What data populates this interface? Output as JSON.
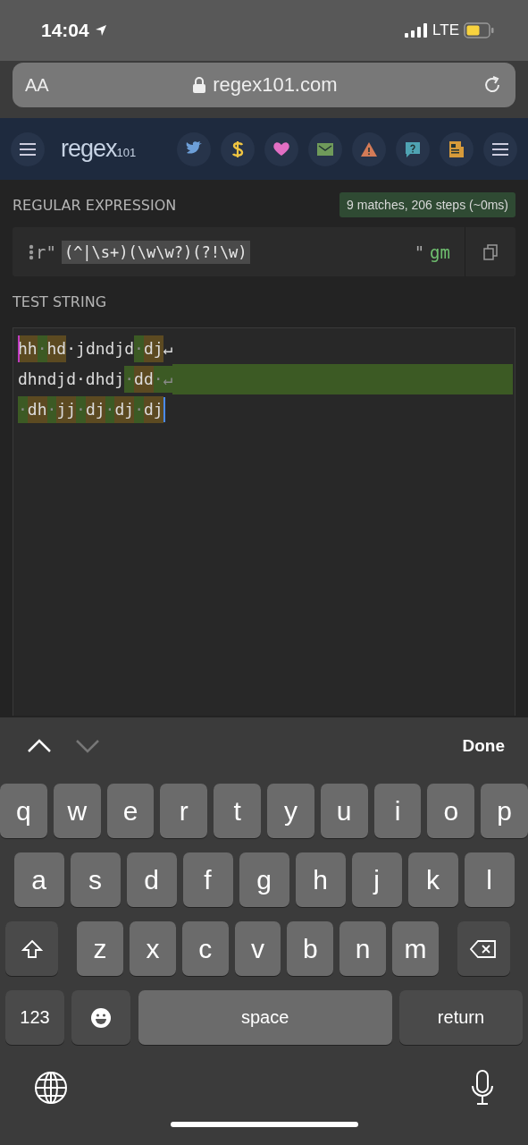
{
  "status_bar": {
    "time": "14:04",
    "network": "LTE"
  },
  "address_bar": {
    "text_size": "AA",
    "url": "regex101.com"
  },
  "nav": {
    "logo": "regex",
    "logo_suffix": "101",
    "buttons": [
      {
        "kind": "twitter"
      },
      {
        "kind": "dollar"
      },
      {
        "kind": "heart"
      },
      {
        "kind": "mail"
      },
      {
        "kind": "warning"
      },
      {
        "kind": "help"
      },
      {
        "kind": "news"
      }
    ]
  },
  "regex": {
    "label": "REGULAR EXPRESSION",
    "match_info": "9 matches, 206 steps (~0ms)",
    "prefix": "r\"",
    "pattern": "(^|\\s+)(\\w\\w?)(?!\\w)",
    "suffix": "\"",
    "flags": "gm"
  },
  "test_string": {
    "label": "TEST STRING",
    "lines": [
      {
        "trailing_match": false,
        "segments": [
          {
            "text": "hh",
            "kind": "word"
          },
          {
            "text": "·",
            "kind": "space"
          },
          {
            "text": "hd",
            "kind": "word"
          },
          {
            "text": "·jdndjd",
            "kind": "plain"
          },
          {
            "text": "·",
            "kind": "space"
          },
          {
            "text": "dj",
            "kind": "word"
          },
          {
            "text": "↵",
            "kind": "plain"
          }
        ]
      },
      {
        "trailing_match": true,
        "segments": [
          {
            "text": "dhndjd·dhdj",
            "kind": "plain"
          },
          {
            "text": "·",
            "kind": "space"
          },
          {
            "text": "dd",
            "kind": "word"
          },
          {
            "text": "·↵",
            "kind": "space"
          }
        ]
      },
      {
        "trailing_match": false,
        "segments": [
          {
            "text": "·",
            "kind": "space"
          },
          {
            "text": "dh",
            "kind": "word"
          },
          {
            "text": "·",
            "kind": "space"
          },
          {
            "text": "jj",
            "kind": "word"
          },
          {
            "text": "·",
            "kind": "space"
          },
          {
            "text": "dj",
            "kind": "word"
          },
          {
            "text": "·",
            "kind": "space"
          },
          {
            "text": "dj",
            "kind": "word"
          },
          {
            "text": "·",
            "kind": "space"
          },
          {
            "text": "dj",
            "kind": "word"
          }
        ]
      }
    ]
  },
  "keyboard": {
    "done": "Done",
    "rows": [
      {
        "keys": [
          {
            "label": "q",
            "kind": "letter"
          },
          {
            "label": "w",
            "kind": "letter"
          },
          {
            "label": "e",
            "kind": "letter"
          },
          {
            "label": "r",
            "kind": "letter"
          },
          {
            "label": "t",
            "kind": "letter"
          },
          {
            "label": "y",
            "kind": "letter"
          },
          {
            "label": "u",
            "kind": "letter"
          },
          {
            "label": "i",
            "kind": "letter"
          },
          {
            "label": "o",
            "kind": "letter"
          },
          {
            "label": "p",
            "kind": "letter"
          }
        ]
      },
      {
        "keys": [
          {
            "label": "a",
            "kind": "letter"
          },
          {
            "label": "s",
            "kind": "letter"
          },
          {
            "label": "d",
            "kind": "letter"
          },
          {
            "label": "f",
            "kind": "letter"
          },
          {
            "label": "g",
            "kind": "letter"
          },
          {
            "label": "h",
            "kind": "letter"
          },
          {
            "label": "j",
            "kind": "letter"
          },
          {
            "label": "k",
            "kind": "letter"
          },
          {
            "label": "l",
            "kind": "letter"
          }
        ]
      },
      {
        "keys": [
          {
            "kind": "shift"
          },
          {
            "label": "z",
            "kind": "letter"
          },
          {
            "label": "x",
            "kind": "letter"
          },
          {
            "label": "c",
            "kind": "letter"
          },
          {
            "label": "v",
            "kind": "letter"
          },
          {
            "label": "b",
            "kind": "letter"
          },
          {
            "label": "n",
            "kind": "letter"
          },
          {
            "label": "m",
            "kind": "letter"
          },
          {
            "kind": "delete"
          }
        ]
      }
    ],
    "bottom_row": [
      {
        "label": "123",
        "kind": "mode"
      },
      {
        "kind": "emoji"
      },
      {
        "label": "space",
        "kind": "space"
      },
      {
        "label": "return",
        "kind": "return"
      }
    ]
  }
}
